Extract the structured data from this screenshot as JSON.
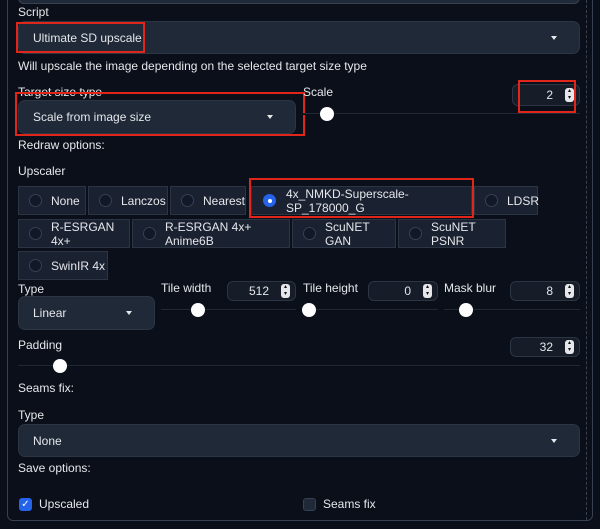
{
  "script": {
    "label": "Script",
    "value": "Ultimate SD upscale",
    "description": "Will upscale the image depending on the selected target size type"
  },
  "target": {
    "label": "Target size type",
    "value": "Scale from image size"
  },
  "scale": {
    "label": "Scale",
    "value": "2"
  },
  "redraw_label": "Redraw options:",
  "upscaler": {
    "label": "Upscaler",
    "options": [
      "None",
      "Lanczos",
      "Nearest",
      "4x_NMKD-Superscale-SP_178000_G",
      "LDSR",
      "R-ESRGAN 4x+",
      "R-ESRGAN 4x+ Anime6B",
      "ScuNET GAN",
      "ScuNET PSNR",
      "SwinIR 4x"
    ],
    "selected": "4x_NMKD-Superscale-SP_178000_G"
  },
  "type": {
    "label": "Type",
    "value": "Linear"
  },
  "tile_width": {
    "label": "Tile width",
    "value": "512"
  },
  "tile_height": {
    "label": "Tile height",
    "value": "0"
  },
  "mask_blur": {
    "label": "Mask blur",
    "value": "8"
  },
  "padding": {
    "label": "Padding",
    "value": "32"
  },
  "seams": {
    "label": "Seams fix:",
    "type_label": "Type",
    "type_value": "None"
  },
  "save": {
    "label": "Save options:",
    "upscaled": {
      "label": "Upscaled",
      "checked": true
    },
    "seams_fix": {
      "label": "Seams fix",
      "checked": false
    }
  },
  "colors": {
    "background": "#0b0f19",
    "accent": "#2563eb",
    "highlight": "#e0261b"
  }
}
